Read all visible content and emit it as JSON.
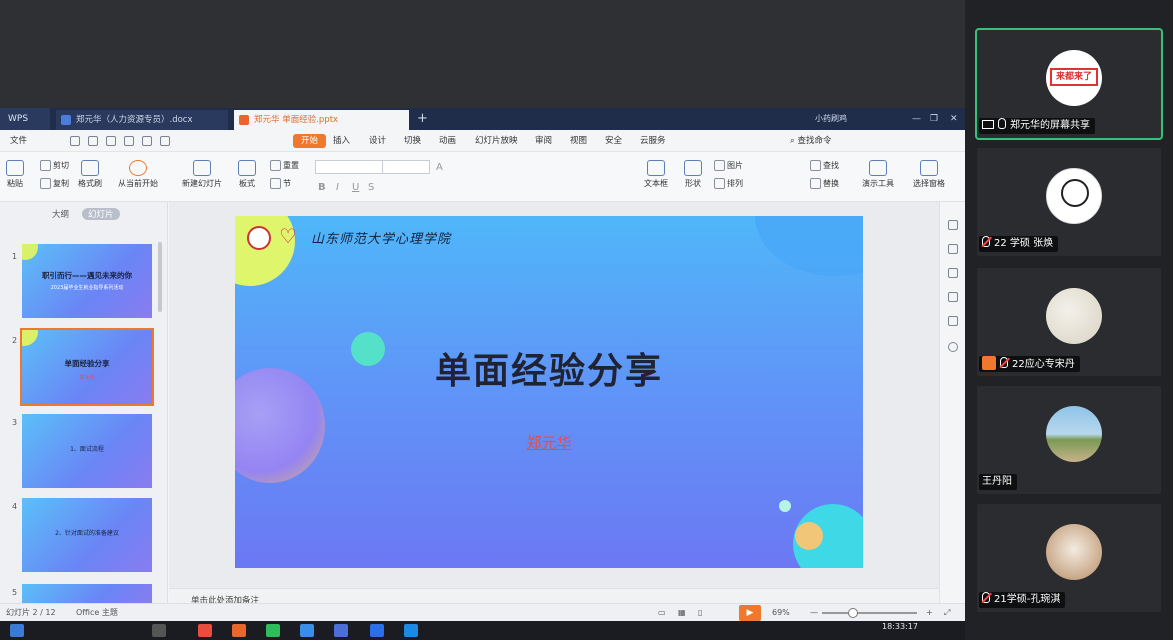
{
  "wps": {
    "brand": "WPS",
    "tabs": [
      {
        "label": "郑元华（人力资源专员）.docx"
      },
      {
        "label": "郑元华 单面经验.pptx"
      }
    ],
    "user_name": "小药刷鸡",
    "menu": [
      "文件",
      "开始",
      "插入",
      "设计",
      "切换",
      "动画",
      "幻灯片放映",
      "审阅",
      "视图",
      "安全",
      "云服务"
    ],
    "search_cmd": "查找命令",
    "ribbon": {
      "paste": "粘贴",
      "cut": "剪切",
      "copy": "复制",
      "format_painter": "格式刷",
      "from_current": "从当前开始",
      "new_slide": "新建幻灯片",
      "layout": "板式",
      "reset": "重置",
      "section": "节",
      "textbox": "文本框",
      "shape": "形状",
      "arrange": "排列",
      "picture": "图片",
      "find": "查找",
      "replace": "替换",
      "show_tools": "演示工具",
      "select_pane": "选择窗格"
    },
    "pane_tabs": [
      "大纲",
      "幻灯片"
    ],
    "thumbnails": [
      {
        "num": "1",
        "title": "职引而行——遇见未来的你",
        "sub": "2023届毕业生就业指导系列活动"
      },
      {
        "num": "2",
        "title": "单面经验分享",
        "sub": "郑元华"
      },
      {
        "num": "3",
        "title": "1、面试流程",
        "sub": ""
      },
      {
        "num": "4",
        "title": "2、针对面试的准备建议",
        "sub": ""
      },
      {
        "num": "5",
        "title": "",
        "sub": ""
      }
    ],
    "slide": {
      "school": "山东师范大学心理学院",
      "title": "单面经验分享",
      "author": "郑元华"
    },
    "notes_placeholder": "单击此处添加备注",
    "status": {
      "slide_counter": "幻灯片 2 / 12",
      "theme": "Office 主题",
      "zoom": "69%",
      "zoom_value": 0.69
    },
    "clock": {
      "time": "18:33:17",
      "date": ""
    }
  },
  "participants": [
    {
      "name": "郑元华的屏幕共享",
      "avatar_text": "来都来了",
      "mic": "on",
      "sharing": true
    },
    {
      "name": "22 学硕 张焕",
      "avatar_text": "",
      "mic": "muted",
      "sharing": false
    },
    {
      "name": "22应心专宋丹",
      "avatar_text": "",
      "mic": "muted",
      "sharing": false
    },
    {
      "name": "王丹阳",
      "avatar_text": "",
      "mic": "none",
      "sharing": false
    },
    {
      "name": "21学硕-孔琬淇",
      "avatar_text": "",
      "mic": "muted",
      "sharing": false
    }
  ],
  "colors": {
    "accent": "#f0782d",
    "active_speaker": "#39c07a",
    "slide_top": "#4fb7f9",
    "slide_bottom": "#6b78f3"
  }
}
